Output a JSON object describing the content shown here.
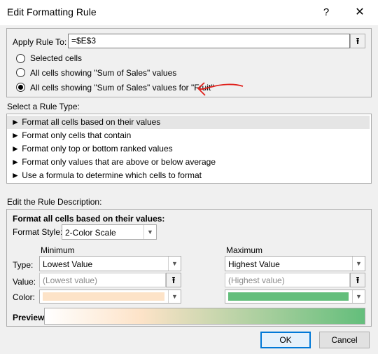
{
  "window": {
    "title": "Edit Formatting Rule",
    "help_glyph": "?",
    "close_glyph": "✕"
  },
  "apply_rule": {
    "label": "Apply Rule To:",
    "value": "=$E$3",
    "options": [
      {
        "label": "Selected cells",
        "checked": false
      },
      {
        "label": "All cells showing \"Sum of Sales\" values",
        "checked": false
      },
      {
        "label": "All cells showing \"Sum of Sales\" values for \"Fruit\"",
        "checked": true
      }
    ]
  },
  "rule_type": {
    "label": "Select a Rule Type:",
    "items": [
      {
        "label": "► Format all cells based on their values",
        "selected": true
      },
      {
        "label": "► Format only cells that contain",
        "selected": false
      },
      {
        "label": "► Format only top or bottom ranked values",
        "selected": false
      },
      {
        "label": "► Format only values that are above or below average",
        "selected": false
      },
      {
        "label": "► Use a formula to determine which cells to format",
        "selected": false
      }
    ]
  },
  "description": {
    "label": "Edit the Rule Description:",
    "heading": "Format all cells based on their values:",
    "format_style_label": "Format Style:",
    "format_style_value": "2-Color Scale",
    "minimum_label": "Minimum",
    "maximum_label": "Maximum",
    "type_label": "Type:",
    "value_label": "Value:",
    "color_label": "Color:",
    "min_type": "Lowest Value",
    "max_type": "Highest Value",
    "min_value_placeholder": "(Lowest value)",
    "max_value_placeholder": "(Highest value)",
    "preview_label": "Preview:",
    "min_color": "#fde3c8",
    "max_color": "#63be7b"
  },
  "buttons": {
    "ok": "OK",
    "cancel": "Cancel"
  },
  "annotation": {
    "color": "#e0201b"
  }
}
